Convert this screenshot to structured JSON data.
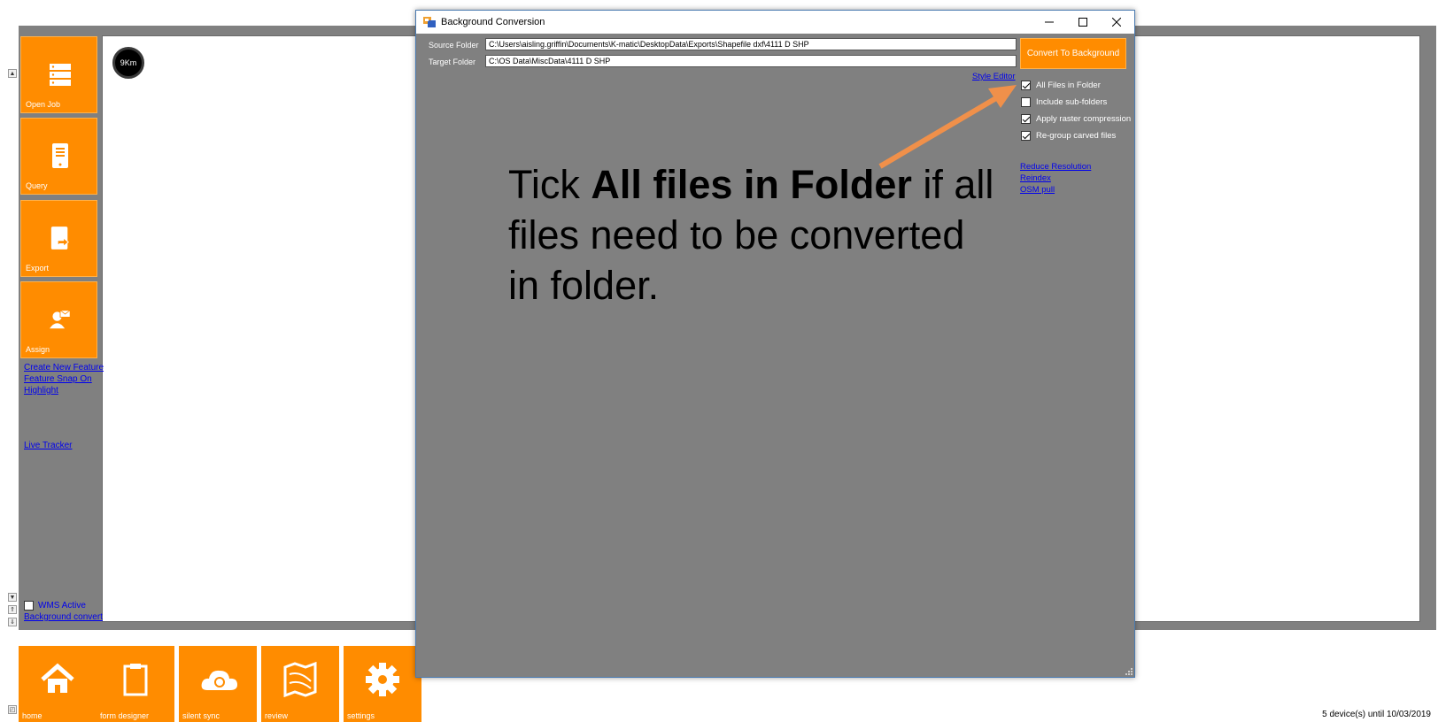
{
  "map": {
    "scale_label": "9Km"
  },
  "sidebar": {
    "tiles": [
      {
        "label": "Open Job",
        "icon": "server-icon"
      },
      {
        "label": "Query",
        "icon": "tablet-icon"
      },
      {
        "label": "Export",
        "icon": "export-icon"
      },
      {
        "label": "Assign",
        "icon": "assign-user-icon"
      }
    ],
    "links": [
      "Create New Feature",
      "Feature Snap On",
      "Highlight",
      "Live Tracker"
    ],
    "wms_label": "WMS Active",
    "background_convert_label": "Background convert"
  },
  "bottom_bar": {
    "tiles": [
      {
        "label": "home",
        "icon": "home-icon"
      },
      {
        "label": "form designer",
        "icon": "clipboard-icon"
      },
      {
        "label": "silent sync",
        "icon": "cloud-sync-icon"
      },
      {
        "label": "review",
        "icon": "map-icon"
      },
      {
        "label": "settings",
        "icon": "gear-icon"
      }
    ]
  },
  "license_text": "5 device(s) until 10/03/2019",
  "dialog": {
    "title": "Background Conversion",
    "source_label": "Source Folder",
    "source_value": "C:\\Users\\aisling.griffin\\Documents\\K-matic\\DesktopData\\Exports\\Shapefile dxf\\4111 D SHP",
    "target_label": "Target Folder",
    "target_value": "C:\\OS Data\\MiscData\\4111 D SHP",
    "convert_button": "Convert To Background",
    "style_editor_link": "Style Editor",
    "options": [
      {
        "label": "All Files in Folder",
        "checked": true
      },
      {
        "label": "Include sub-folders",
        "checked": false
      },
      {
        "label": "Apply raster compression",
        "checked": true
      },
      {
        "label": "Re-group carved files",
        "checked": true
      }
    ],
    "links": [
      "Reduce Resolution",
      "Reindex",
      "OSM pull"
    ]
  },
  "callout": {
    "prefix": "Tick ",
    "bold": "All files in Folder",
    "suffix": " if all files need to be converted in folder."
  },
  "colors": {
    "accent": "#ff8c00",
    "arrow": "#f0904a",
    "panel": "#808080"
  }
}
